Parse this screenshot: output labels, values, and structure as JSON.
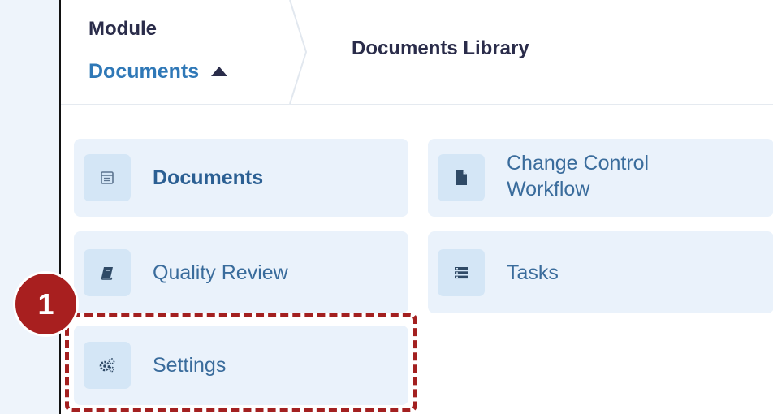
{
  "breadcrumb": {
    "module_label": "Module",
    "module_value": "Documents",
    "current_page": "Documents Library"
  },
  "tiles": [
    {
      "label": "Documents",
      "icon": "calendar-icon"
    },
    {
      "label": "Change Control Workflow",
      "icon": "file-icon"
    },
    {
      "label": "Quality Review",
      "icon": "book-icon"
    },
    {
      "label": "Tasks",
      "icon": "list-icon"
    },
    {
      "label": "Settings",
      "icon": "gears-icon"
    }
  ],
  "annotation": {
    "step_number": "1"
  },
  "colors": {
    "accent": "#2f78b7",
    "tile_bg": "#eaf2fb",
    "icon_bg": "#d4e6f6",
    "annotation_red": "#a81f1f"
  }
}
